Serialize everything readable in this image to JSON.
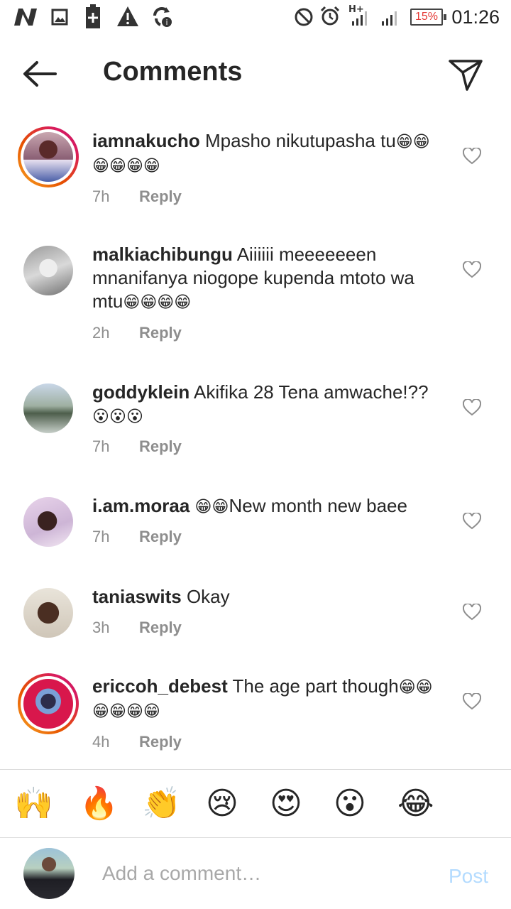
{
  "status_bar": {
    "time": "01:26",
    "battery": "15%",
    "network": "H+",
    "left_icons": [
      "n-logo-icon",
      "image-icon",
      "battery-plus-icon",
      "warning-icon",
      "sync-icon"
    ],
    "right_icons": [
      "do-not-disturb-icon",
      "alarm-icon",
      "signal-h-plus-icon",
      "signal-icon"
    ]
  },
  "header": {
    "title": "Comments",
    "back_icon": "back-arrow-icon",
    "send_icon": "send-icon"
  },
  "comments": [
    {
      "username": "iamnakucho",
      "text": "Mpasho nikutupasha tu",
      "emojis": "😁😁😁😁😁😁",
      "time": "7h",
      "reply": "Reply",
      "has_story_ring": true
    },
    {
      "username": "malkiachibungu",
      "text": "Aiiiiii meeeeeeen mnanifanya niogope kupenda mtoto wa mtu",
      "emojis": "😁😁😁😁",
      "time": "2h",
      "reply": "Reply",
      "has_story_ring": false
    },
    {
      "username": "goddyklein",
      "text": "Akifika 28 Tena amwache!??",
      "emojis": "😮😮😮",
      "time": "7h",
      "reply": "Reply",
      "has_story_ring": false
    },
    {
      "username": "i.am.moraa",
      "text_prefix_emojis": "😁😁",
      "text": "New month new baee",
      "time": "7h",
      "reply": "Reply",
      "has_story_ring": false
    },
    {
      "username": "taniaswits",
      "text": "Okay",
      "time": "3h",
      "reply": "Reply",
      "has_story_ring": false
    },
    {
      "username": "ericcoh_debest",
      "text": "The age part though",
      "emojis": "😁😁😁😁😁😁",
      "time": "4h",
      "reply": "Reply",
      "has_story_ring": true
    }
  ],
  "quick_emojis": [
    "🙌",
    "🔥",
    "👏",
    "😢",
    "😍",
    "😮",
    "😂"
  ],
  "composer": {
    "placeholder": "Add a comment…",
    "post_label": "Post"
  },
  "colors": {
    "text": "#262626",
    "muted": "#8e8e8e",
    "post_disabled": "#b3dbff",
    "battery_low": "#e53935",
    "story_ring_start": "#f9a825",
    "story_ring_end": "#c2185b"
  }
}
